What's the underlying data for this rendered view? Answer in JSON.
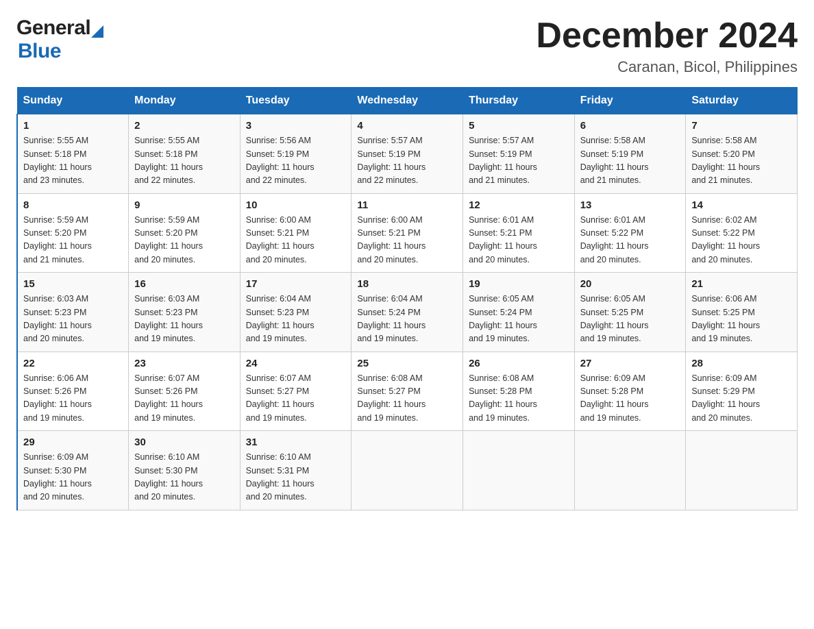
{
  "logo": {
    "general": "General",
    "blue": "Blue"
  },
  "title": "December 2024",
  "location": "Caranan, Bicol, Philippines",
  "days_of_week": [
    "Sunday",
    "Monday",
    "Tuesday",
    "Wednesday",
    "Thursday",
    "Friday",
    "Saturday"
  ],
  "weeks": [
    [
      {
        "day": "1",
        "info": "Sunrise: 5:55 AM\nSunset: 5:18 PM\nDaylight: 11 hours\nand 23 minutes."
      },
      {
        "day": "2",
        "info": "Sunrise: 5:55 AM\nSunset: 5:18 PM\nDaylight: 11 hours\nand 22 minutes."
      },
      {
        "day": "3",
        "info": "Sunrise: 5:56 AM\nSunset: 5:19 PM\nDaylight: 11 hours\nand 22 minutes."
      },
      {
        "day": "4",
        "info": "Sunrise: 5:57 AM\nSunset: 5:19 PM\nDaylight: 11 hours\nand 22 minutes."
      },
      {
        "day": "5",
        "info": "Sunrise: 5:57 AM\nSunset: 5:19 PM\nDaylight: 11 hours\nand 21 minutes."
      },
      {
        "day": "6",
        "info": "Sunrise: 5:58 AM\nSunset: 5:19 PM\nDaylight: 11 hours\nand 21 minutes."
      },
      {
        "day": "7",
        "info": "Sunrise: 5:58 AM\nSunset: 5:20 PM\nDaylight: 11 hours\nand 21 minutes."
      }
    ],
    [
      {
        "day": "8",
        "info": "Sunrise: 5:59 AM\nSunset: 5:20 PM\nDaylight: 11 hours\nand 21 minutes."
      },
      {
        "day": "9",
        "info": "Sunrise: 5:59 AM\nSunset: 5:20 PM\nDaylight: 11 hours\nand 20 minutes."
      },
      {
        "day": "10",
        "info": "Sunrise: 6:00 AM\nSunset: 5:21 PM\nDaylight: 11 hours\nand 20 minutes."
      },
      {
        "day": "11",
        "info": "Sunrise: 6:00 AM\nSunset: 5:21 PM\nDaylight: 11 hours\nand 20 minutes."
      },
      {
        "day": "12",
        "info": "Sunrise: 6:01 AM\nSunset: 5:21 PM\nDaylight: 11 hours\nand 20 minutes."
      },
      {
        "day": "13",
        "info": "Sunrise: 6:01 AM\nSunset: 5:22 PM\nDaylight: 11 hours\nand 20 minutes."
      },
      {
        "day": "14",
        "info": "Sunrise: 6:02 AM\nSunset: 5:22 PM\nDaylight: 11 hours\nand 20 minutes."
      }
    ],
    [
      {
        "day": "15",
        "info": "Sunrise: 6:03 AM\nSunset: 5:23 PM\nDaylight: 11 hours\nand 20 minutes."
      },
      {
        "day": "16",
        "info": "Sunrise: 6:03 AM\nSunset: 5:23 PM\nDaylight: 11 hours\nand 19 minutes."
      },
      {
        "day": "17",
        "info": "Sunrise: 6:04 AM\nSunset: 5:23 PM\nDaylight: 11 hours\nand 19 minutes."
      },
      {
        "day": "18",
        "info": "Sunrise: 6:04 AM\nSunset: 5:24 PM\nDaylight: 11 hours\nand 19 minutes."
      },
      {
        "day": "19",
        "info": "Sunrise: 6:05 AM\nSunset: 5:24 PM\nDaylight: 11 hours\nand 19 minutes."
      },
      {
        "day": "20",
        "info": "Sunrise: 6:05 AM\nSunset: 5:25 PM\nDaylight: 11 hours\nand 19 minutes."
      },
      {
        "day": "21",
        "info": "Sunrise: 6:06 AM\nSunset: 5:25 PM\nDaylight: 11 hours\nand 19 minutes."
      }
    ],
    [
      {
        "day": "22",
        "info": "Sunrise: 6:06 AM\nSunset: 5:26 PM\nDaylight: 11 hours\nand 19 minutes."
      },
      {
        "day": "23",
        "info": "Sunrise: 6:07 AM\nSunset: 5:26 PM\nDaylight: 11 hours\nand 19 minutes."
      },
      {
        "day": "24",
        "info": "Sunrise: 6:07 AM\nSunset: 5:27 PM\nDaylight: 11 hours\nand 19 minutes."
      },
      {
        "day": "25",
        "info": "Sunrise: 6:08 AM\nSunset: 5:27 PM\nDaylight: 11 hours\nand 19 minutes."
      },
      {
        "day": "26",
        "info": "Sunrise: 6:08 AM\nSunset: 5:28 PM\nDaylight: 11 hours\nand 19 minutes."
      },
      {
        "day": "27",
        "info": "Sunrise: 6:09 AM\nSunset: 5:28 PM\nDaylight: 11 hours\nand 19 minutes."
      },
      {
        "day": "28",
        "info": "Sunrise: 6:09 AM\nSunset: 5:29 PM\nDaylight: 11 hours\nand 20 minutes."
      }
    ],
    [
      {
        "day": "29",
        "info": "Sunrise: 6:09 AM\nSunset: 5:30 PM\nDaylight: 11 hours\nand 20 minutes."
      },
      {
        "day": "30",
        "info": "Sunrise: 6:10 AM\nSunset: 5:30 PM\nDaylight: 11 hours\nand 20 minutes."
      },
      {
        "day": "31",
        "info": "Sunrise: 6:10 AM\nSunset: 5:31 PM\nDaylight: 11 hours\nand 20 minutes."
      },
      {
        "day": "",
        "info": ""
      },
      {
        "day": "",
        "info": ""
      },
      {
        "day": "",
        "info": ""
      },
      {
        "day": "",
        "info": ""
      }
    ]
  ]
}
